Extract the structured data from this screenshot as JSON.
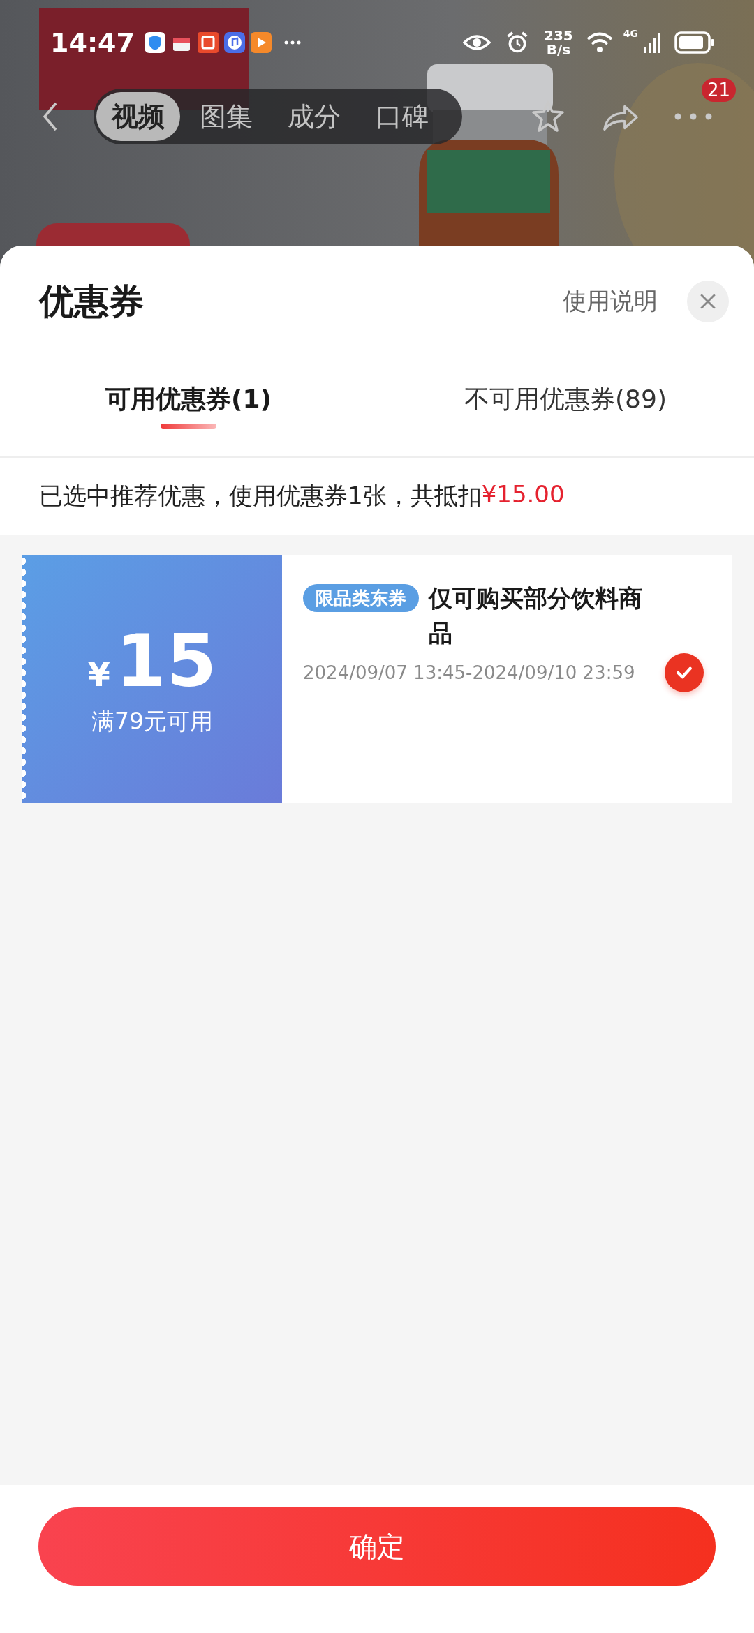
{
  "status_bar": {
    "time": "14:47",
    "net_speed_value": "235",
    "net_speed_unit": "B/s",
    "network": "4G"
  },
  "nav": {
    "tabs": [
      {
        "label": "视频",
        "selected": true
      },
      {
        "label": "图集",
        "selected": false
      },
      {
        "label": "成分",
        "selected": false
      },
      {
        "label": "口碑",
        "selected": false
      }
    ],
    "badge": "21"
  },
  "sheet": {
    "title": "优惠券",
    "help": "使用说明",
    "tabs": [
      {
        "label": "可用优惠券(1)",
        "selected": true
      },
      {
        "label": "不可用优惠券(89)",
        "selected": false
      }
    ],
    "summary_text": "已选中推荐优惠，使用优惠券1张，共抵扣",
    "summary_amount": "¥15.00",
    "coupons": [
      {
        "currency": "¥",
        "amount": "15",
        "condition": "满79元可用",
        "tag": "限品类东券",
        "title": "仅可购买部分饮料商品",
        "validity": "2024/09/07 13:45-2024/09/10 23:59",
        "selected": true
      }
    ],
    "confirm": "确定"
  }
}
